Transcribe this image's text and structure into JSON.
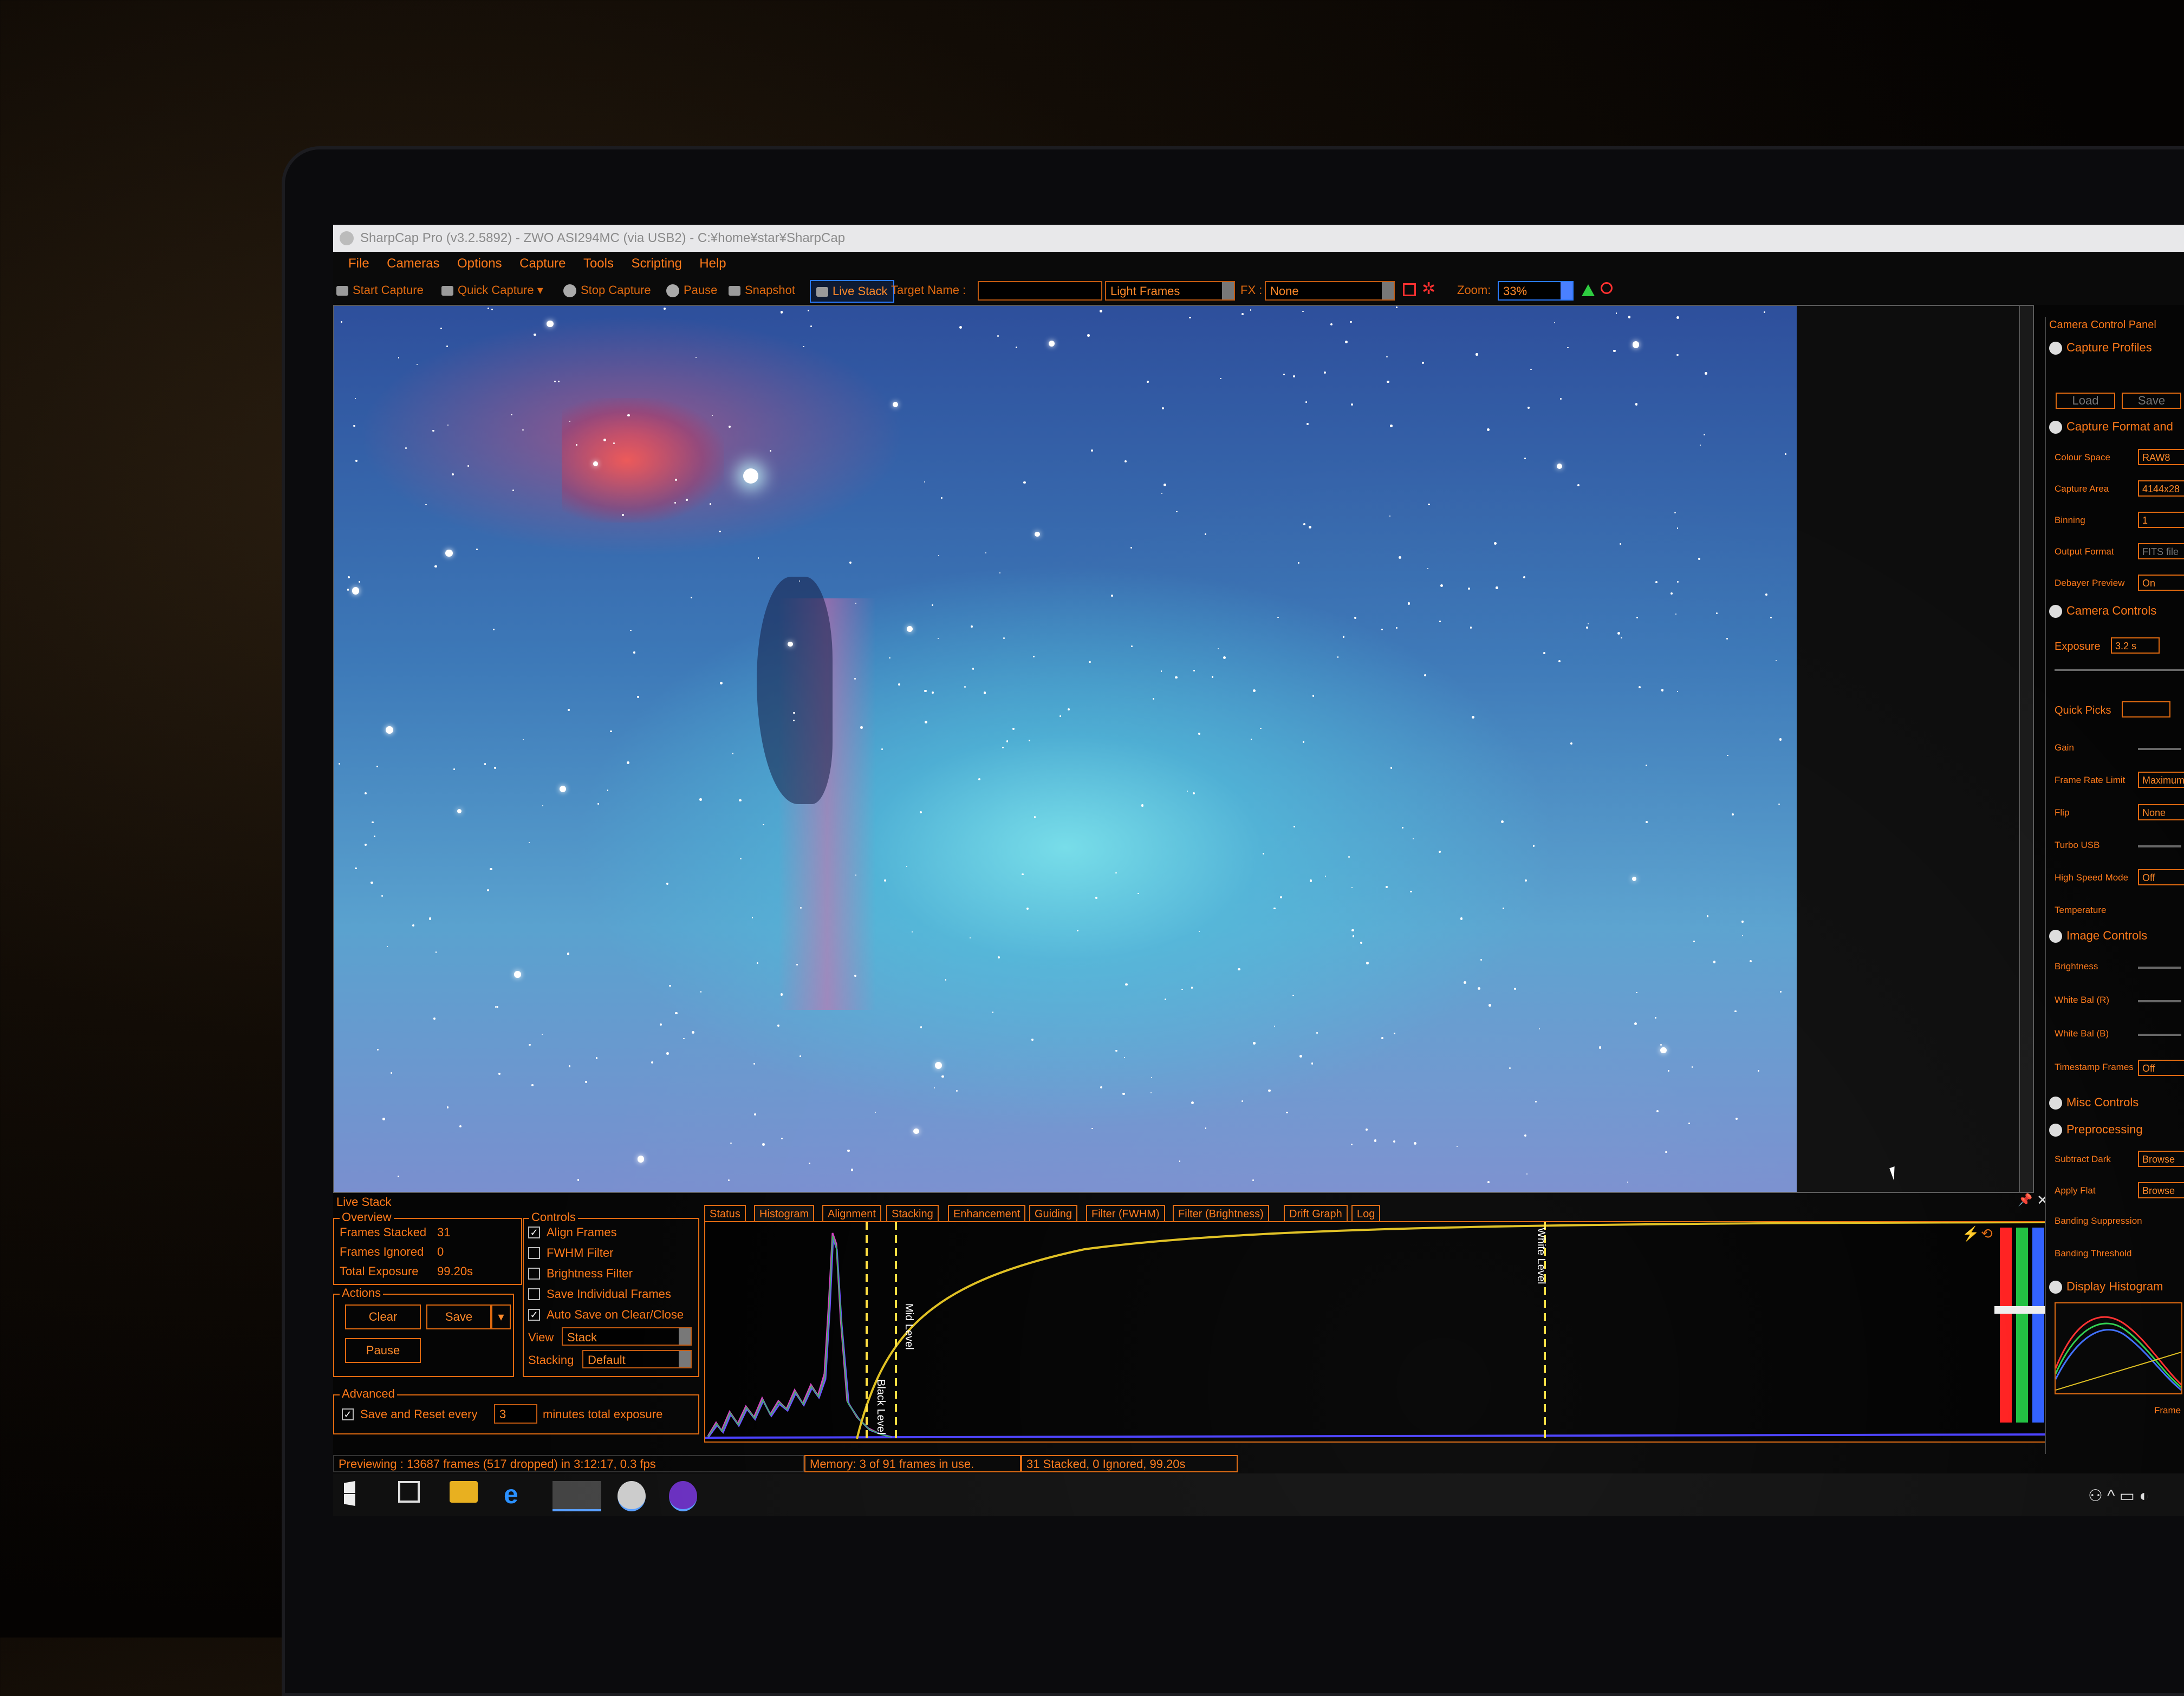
{
  "window": {
    "title": "SharpCap Pro (v3.2.5892) - ZWO ASI294MC (via USB2) - C:¥home¥star¥SharpCap"
  },
  "menu": [
    "File",
    "Cameras",
    "Options",
    "Capture",
    "Tools",
    "Scripting",
    "Help"
  ],
  "toolbar": {
    "start_capture": "Start Capture",
    "quick_capture": "Quick Capture",
    "stop_capture": "Stop Capture",
    "pause": "Pause",
    "snapshot": "Snapshot",
    "live_stack": "Live Stack",
    "target_name_label": "Target Name :",
    "target_name_value": "",
    "frame_type": "Light Frames",
    "fx_label": "FX :",
    "fx_value": "None",
    "zoom_label": "Zoom:",
    "zoom_value": "33%"
  },
  "live_stack": {
    "panel_title": "Live Stack",
    "overview": {
      "title": "Overview",
      "frames_stacked_label": "Frames Stacked",
      "frames_stacked": "31",
      "frames_ignored_label": "Frames Ignored",
      "frames_ignored": "0",
      "total_exposure_label": "Total Exposure",
      "total_exposure": "99.20s"
    },
    "actions": {
      "title": "Actions",
      "clear": "Clear",
      "save": "Save",
      "pause": "Pause"
    },
    "controls": {
      "title": "Controls",
      "align_frames": "Align Frames",
      "fwhm_filter": "FWHM Filter",
      "brightness_filter": "Brightness Filter",
      "save_individual": "Save Individual Frames",
      "auto_save": "Auto Save on Clear/Close",
      "view_label": "View",
      "view_value": "Stack",
      "stacking_label": "Stacking",
      "stacking_value": "Default"
    },
    "advanced": {
      "title": "Advanced",
      "save_reset_label": "Save and Reset every",
      "save_reset_value": "3",
      "save_reset_suffix": "minutes total exposure"
    },
    "tabs": [
      "Status",
      "Histogram",
      "Alignment",
      "Stacking",
      "Enhancement",
      "Guiding",
      "Filter (FWHM)",
      "Filter (Brightness)",
      "Drift Graph",
      "Log"
    ],
    "active_tab": "Histogram",
    "histogram": {
      "black_level_label": "Black Level",
      "mid_level_label": "Mid Level",
      "white_level_label": "White Level"
    }
  },
  "status_bar": {
    "preview": "Previewing : 13687 frames (517 dropped) in 3:12:17, 0.3 fps",
    "memory": "Memory: 3 of 91 frames in use.",
    "stacked": "31 Stacked, 0 Ignored, 99.20s"
  },
  "camera_panel": {
    "title": "Camera Control Panel",
    "capture_profiles": "Capture Profiles",
    "load": "Load",
    "save": "Save",
    "capture_format": "Capture Format and",
    "rows_format": [
      {
        "label": "Colour Space",
        "value": "RAW8"
      },
      {
        "label": "Capture Area",
        "value": "4144x28"
      },
      {
        "label": "Binning",
        "value": "1"
      },
      {
        "label": "Output Format",
        "value": "FITS file"
      },
      {
        "label": "Debayer Preview",
        "value": "On"
      }
    ],
    "camera_controls": "Camera Controls",
    "exposure_label": "Exposure",
    "exposure_value": "3.2 s",
    "quick_picks": "Quick Picks",
    "rows_camera": [
      {
        "label": "Gain",
        "value": ""
      },
      {
        "label": "Frame Rate Limit",
        "value": "Maximum"
      },
      {
        "label": "Flip",
        "value": "None"
      },
      {
        "label": "Turbo USB",
        "value": ""
      },
      {
        "label": "High Speed Mode",
        "value": "Off"
      },
      {
        "label": "Temperature",
        "value": ""
      }
    ],
    "image_controls": "Image Controls",
    "rows_image": [
      {
        "label": "Brightness",
        "value": ""
      },
      {
        "label": "White Bal (R)",
        "value": ""
      },
      {
        "label": "White Bal (B)",
        "value": ""
      },
      {
        "label": "Timestamp Frames",
        "value": "Off"
      }
    ],
    "misc_controls": "Misc Controls",
    "preprocessing": "Preprocessing",
    "rows_pre": [
      {
        "label": "Subtract Dark",
        "value": "Browse"
      },
      {
        "label": "Apply Flat",
        "value": "Browse"
      },
      {
        "label": "Banding Suppression",
        "value": ""
      },
      {
        "label": "Banding Threshold",
        "value": ""
      }
    ],
    "display_histogram": "Display Histogram",
    "frames_label": "Frame"
  },
  "colors": {
    "accent": "#ff7a1a",
    "border": "#e06a10",
    "background": "#050505"
  }
}
